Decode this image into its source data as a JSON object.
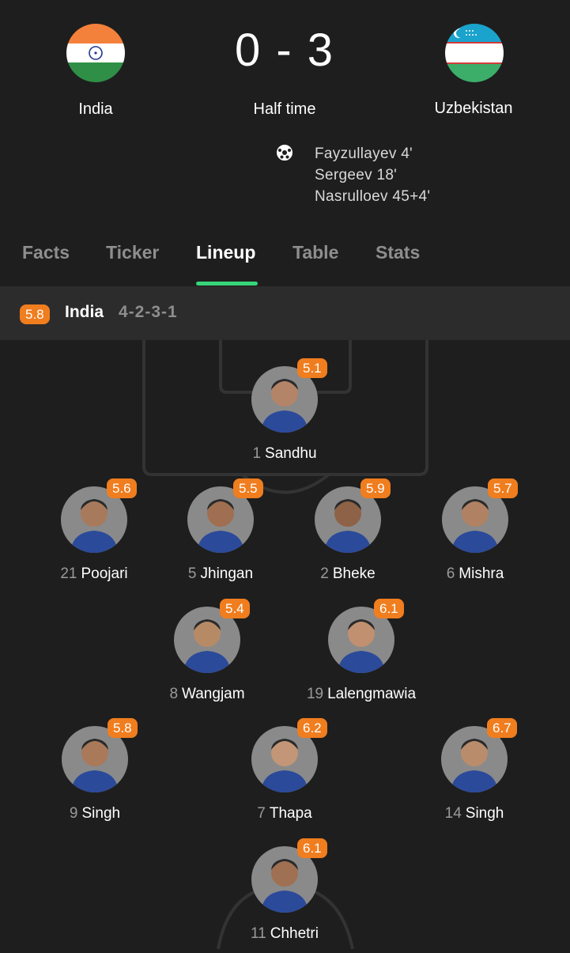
{
  "match": {
    "home_team": "India",
    "away_team": "Uzbekistan",
    "score": "0 - 3",
    "status": "Half time",
    "goals": [
      "Fayzullayev 4'",
      "Sergeev 18'",
      "Nasrulloev 45+4'"
    ]
  },
  "tabs": [
    "Facts",
    "Ticker",
    "Lineup",
    "Table",
    "Stats"
  ],
  "active_tab": "Lineup",
  "lineup": {
    "team_rating": "5.8",
    "team": "India",
    "formation": "4-2-3-1",
    "players": [
      {
        "number": "1",
        "name": "Sandhu",
        "rating": "5.1"
      },
      {
        "number": "21",
        "name": "Poojari",
        "rating": "5.6"
      },
      {
        "number": "5",
        "name": "Jhingan",
        "rating": "5.5"
      },
      {
        "number": "2",
        "name": "Bheke",
        "rating": "5.9"
      },
      {
        "number": "6",
        "name": "Mishra",
        "rating": "5.7"
      },
      {
        "number": "8",
        "name": "Wangjam",
        "rating": "5.4"
      },
      {
        "number": "19",
        "name": "Lalengmawia",
        "rating": "6.1"
      },
      {
        "number": "9",
        "name": "Singh",
        "rating": "5.8"
      },
      {
        "number": "7",
        "name": "Thapa",
        "rating": "6.2"
      },
      {
        "number": "14",
        "name": "Singh",
        "rating": "6.7"
      },
      {
        "number": "11",
        "name": "Chhetri",
        "rating": "6.1"
      }
    ]
  },
  "colors": {
    "background": "#1e1e1e",
    "rating_badge": "#f07d1e",
    "active_tab_underline": "#37d57a",
    "india_saffron": "#f4813b",
    "india_green": "#2f8f46",
    "uzbekistan_blue": "#1aa3cc",
    "uzbekistan_green": "#3cae6a"
  }
}
